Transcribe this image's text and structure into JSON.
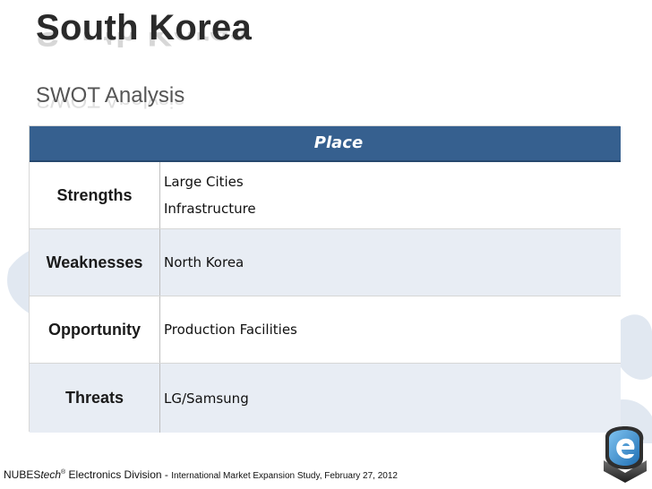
{
  "slide": {
    "title": "South Korea",
    "subtitle": "SWOT Analysis"
  },
  "swot": {
    "header": "Place",
    "rows": [
      {
        "label": "Strengths",
        "items": [
          "Large Cities",
          "Infrastructure"
        ]
      },
      {
        "label": "Weaknesses",
        "items": [
          "North Korea"
        ]
      },
      {
        "label": "Opportunity",
        "items": [
          "Production Facilities"
        ]
      },
      {
        "label": "Threats",
        "items": [
          "LG/Samsung"
        ]
      }
    ]
  },
  "footer": {
    "brand_prefix": "NUBES",
    "brand_italic": "tech",
    "registered": "®",
    "division": " Electronics Division - ",
    "study": "International Market Expansion Study, February 27, 2012"
  },
  "colors": {
    "header_bg": "#36608f",
    "alt_row_bg": "#e8edf4",
    "logo_accent": "#2f7fc1"
  },
  "icons": {
    "logo": "nubestech-logo-icon",
    "background": "world-map-icon"
  }
}
